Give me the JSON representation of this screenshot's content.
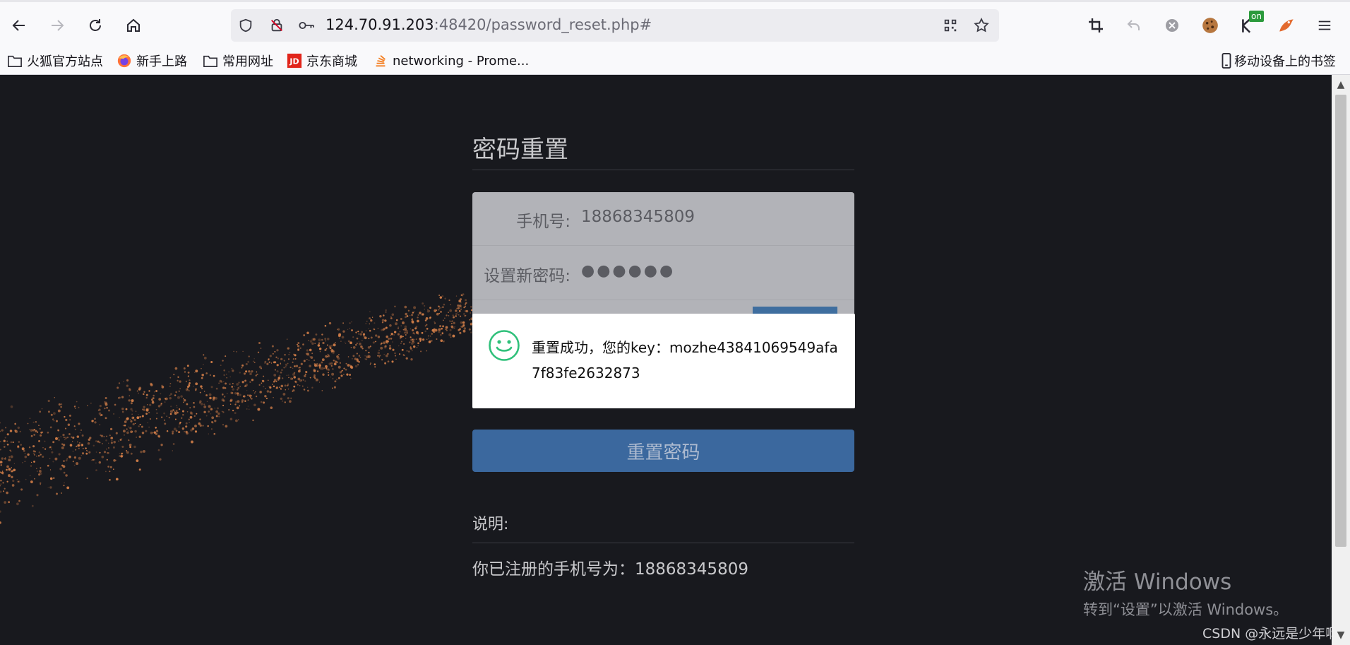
{
  "browser": {
    "url_host": "124.70.91.203",
    "url_path": ":48420/password_reset.php#",
    "extension_badge": "on"
  },
  "bookmarks": [
    {
      "label": "火狐官方站点",
      "icon": "folder-icon"
    },
    {
      "label": "新手上路",
      "icon": "firefox-icon"
    },
    {
      "label": "常用网址",
      "icon": "folder-icon"
    },
    {
      "label": "京东商城",
      "icon": "jd-icon"
    },
    {
      "label": "networking - Prome...",
      "icon": "stack-icon"
    }
  ],
  "mobile_bookmarks": "移动设备上的书签",
  "page": {
    "title": "密码重置",
    "phone_label": "手机号:",
    "phone_value": "18868345809",
    "password_label": "设置新密码:",
    "password_value": "●●●●●●",
    "toast_message": "重置成功，您的key：mozhe43841069549afa7f83fe2632873",
    "reset_button": "重置密码",
    "note_label": "说明:",
    "note_text": "你已注册的手机号为：18868345809"
  },
  "watermark": {
    "title": "激活 Windows",
    "subtitle": "转到“设置”以激活 Windows。",
    "csdn": "CSDN @永远是少年啊"
  },
  "colors": {
    "page_bg": "#18191e",
    "button": "#3b689e",
    "toast_icon": "#2fc07a",
    "particle": "#d9824a"
  }
}
